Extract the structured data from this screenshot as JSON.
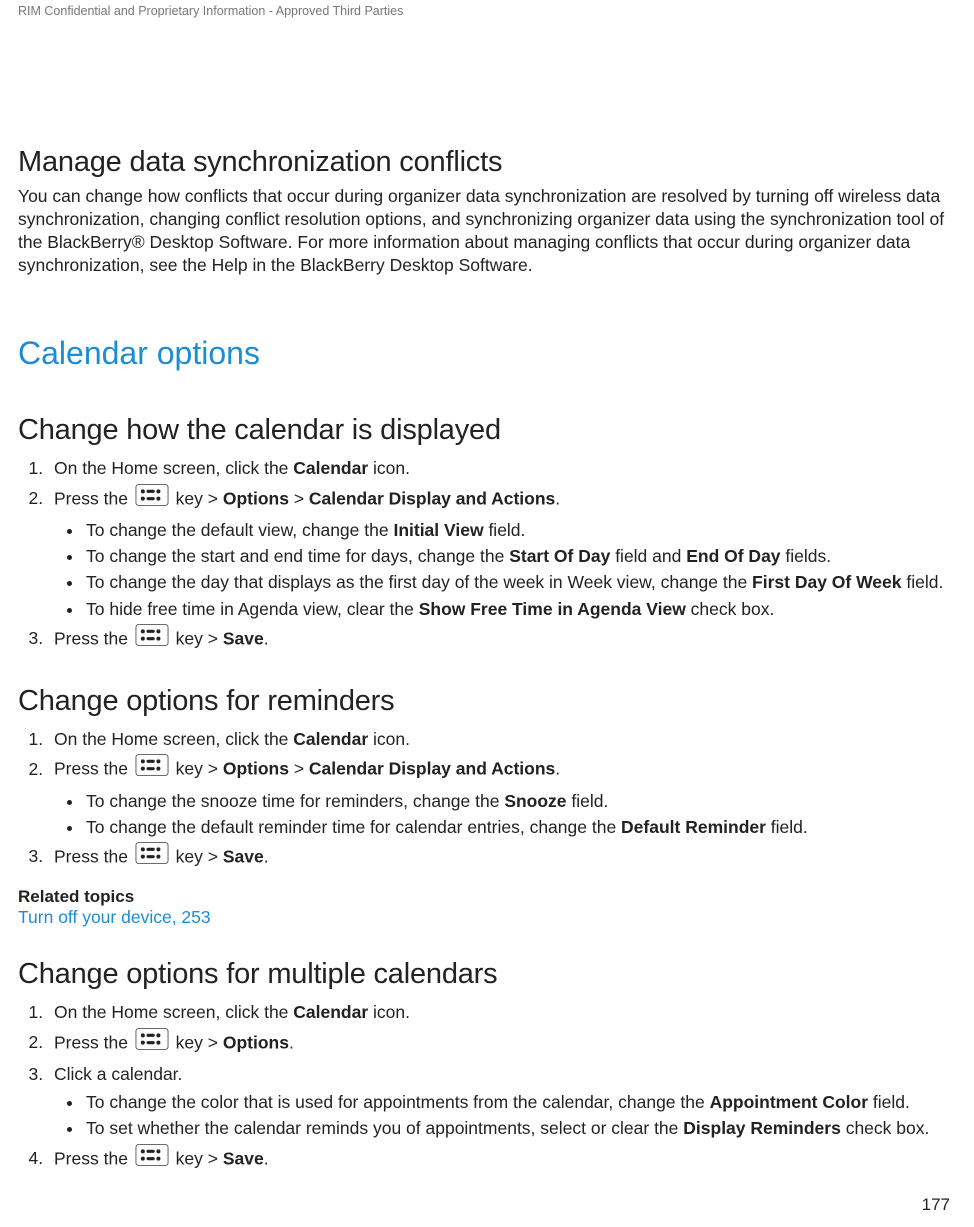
{
  "header": {
    "confidential": "RIM Confidential and Proprietary Information - Approved Third Parties"
  },
  "sec1": {
    "title": "Manage data synchronization conflicts",
    "body": "You can change how conflicts that occur during organizer data synchronization are resolved by turning off wireless data synchronization, changing conflict resolution options, and synchronizing organizer data using the synchronization tool of the BlackBerry® Desktop Software. For more information about managing conflicts that occur during organizer data synchronization, see the Help in the BlackBerry Desktop Software."
  },
  "sec2": {
    "title": "Calendar options"
  },
  "display": {
    "title": "Change how the calendar is displayed",
    "step1_a": "On the Home screen, click the ",
    "step1_b": "Calendar",
    "step1_c": " icon.",
    "step2_a": "Press the ",
    "step2_b": " key > ",
    "step2_c": "Options",
    "step2_d": " > ",
    "step2_e": "Calendar Display and Actions",
    "step2_f": ".",
    "b1_a": "To change the default view, change the ",
    "b1_b": "Initial View",
    "b1_c": " field.",
    "b2_a": "To change the start and end time for days, change the ",
    "b2_b": "Start Of Day",
    "b2_c": " field and ",
    "b2_d": "End Of Day",
    "b2_e": " fields.",
    "b3_a": "To change the day that displays as the first day of the week in Week view, change the ",
    "b3_b": "First Day Of Week",
    "b3_c": " field.",
    "b4_a": "To hide free time in Agenda view, clear the ",
    "b4_b": "Show Free Time in Agenda View",
    "b4_c": " check box.",
    "step3_a": "Press the ",
    "step3_b": " key > ",
    "step3_c": "Save",
    "step3_d": "."
  },
  "reminders": {
    "title": "Change options for reminders",
    "step1_a": "On the Home screen, click the ",
    "step1_b": "Calendar",
    "step1_c": " icon.",
    "step2_a": "Press the ",
    "step2_b": " key > ",
    "step2_c": "Options",
    "step2_d": " > ",
    "step2_e": "Calendar Display and Actions",
    "step2_f": ".",
    "b1_a": "To change the snooze time for reminders, change the ",
    "b1_b": "Snooze",
    "b1_c": " field.",
    "b2_a": "To change the default reminder time for calendar entries, change the ",
    "b2_b": "Default Reminder",
    "b2_c": " field.",
    "step3_a": "Press the ",
    "step3_b": " key > ",
    "step3_c": "Save",
    "step3_d": "."
  },
  "related": {
    "heading": "Related topics",
    "link": "Turn off your device, 253"
  },
  "multi": {
    "title": "Change options for multiple calendars",
    "step1_a": "On the Home screen, click the ",
    "step1_b": "Calendar",
    "step1_c": " icon.",
    "step2_a": "Press the ",
    "step2_b": " key > ",
    "step2_c": "Options",
    "step2_d": ".",
    "step3": "Click a calendar.",
    "b1_a": "To change the color that is used for appointments from the calendar, change the ",
    "b1_b": "Appointment Color",
    "b1_c": " field.",
    "b2_a": "To set whether the calendar reminds you of appointments, select or clear the ",
    "b2_b": "Display Reminders",
    "b2_c": " check box.",
    "step4_a": "Press the ",
    "step4_b": " key > ",
    "step4_c": "Save",
    "step4_d": "."
  },
  "page_number": "177"
}
